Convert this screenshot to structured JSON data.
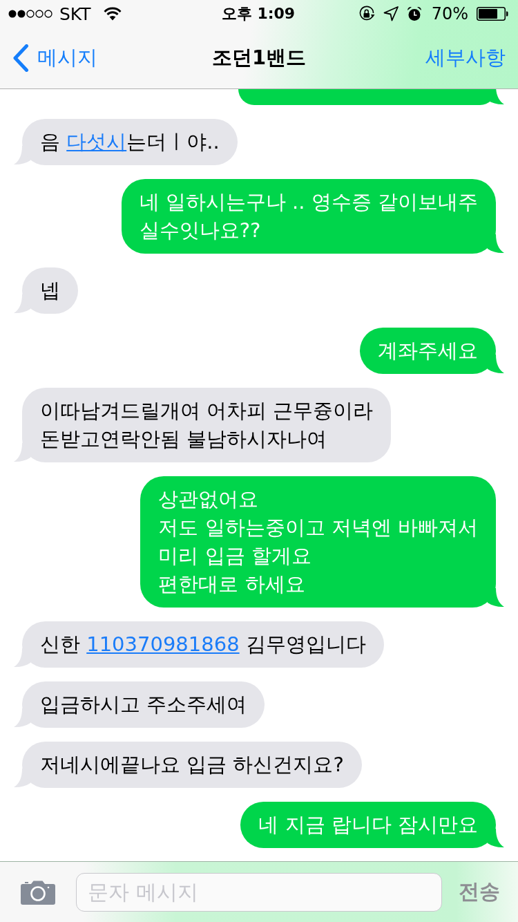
{
  "status_bar": {
    "carrier": "SKT",
    "time": "오후 1:09",
    "battery": "70%"
  },
  "nav_bar": {
    "back": "메시지",
    "title": "조던1밴드",
    "details": "세부사항"
  },
  "messages": [
    {
      "kind": "sent"
    },
    {
      "kind": "received",
      "parts": [
        {
          "kind": "text",
          "text": "음 "
        },
        {
          "kind": "link",
          "text": "다섯시"
        },
        {
          "kind": "text",
          "text": "는더ㅣ야.."
        }
      ]
    },
    {
      "kind": "sent",
      "parts": [
        {
          "kind": "text",
          "text": "네 일하시는구나 .. 영수증 같이보내주\n실수잇나요??"
        }
      ]
    },
    {
      "kind": "received",
      "parts": [
        {
          "kind": "text",
          "text": "넵"
        }
      ]
    },
    {
      "kind": "sent",
      "parts": [
        {
          "kind": "text",
          "text": "계좌주세요"
        }
      ]
    },
    {
      "kind": "received",
      "parts": [
        {
          "kind": "text",
          "text": "이따남겨드릴개여 어차피 근무즁이라\n돈받고연락안됨 불남하시자나여"
        }
      ]
    },
    {
      "kind": "sent",
      "parts": [
        {
          "kind": "text",
          "text": "상관없어요\n저도 일하는중이고 저녁엔 바빠져서\n미리 입금 할게요\n편한대로 하세요"
        }
      ]
    },
    {
      "kind": "received",
      "parts": [
        {
          "kind": "text",
          "text": "신한 "
        },
        {
          "kind": "link",
          "text": "110370981868"
        },
        {
          "kind": "text",
          "text": " 김무영입니다"
        }
      ]
    },
    {
      "kind": "received",
      "parts": [
        {
          "kind": "text",
          "text": "입금하시고 주소주세여"
        }
      ]
    },
    {
      "kind": "received",
      "parts": [
        {
          "kind": "text",
          "text": "저네시에끝나요 입금 하신건지요?"
        }
      ]
    },
    {
      "kind": "sent",
      "parts": [
        {
          "kind": "text",
          "text": "네 지금 랍니다 잠시만요"
        }
      ]
    }
  ],
  "input_bar": {
    "placeholder": "문자 메시지",
    "send_button": {
      "label": "전송",
      "disabled": true
    }
  }
}
